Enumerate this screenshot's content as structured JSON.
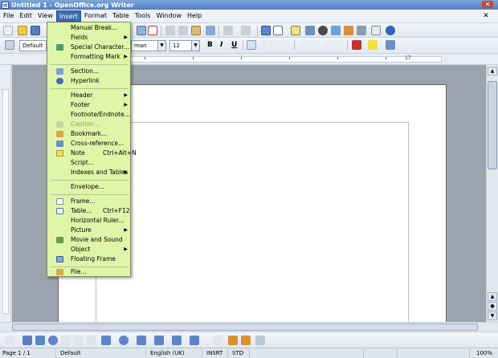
{
  "window": {
    "title": "Untitled 1 - OpenOffice.org Writer"
  },
  "menubar": [
    "File",
    "Edit",
    "View",
    "Insert",
    "Format",
    "Table",
    "Tools",
    "Window",
    "Help"
  ],
  "menubar_active": "Insert",
  "formatting": {
    "style": "Default",
    "font": "man",
    "size": "12"
  },
  "insert_menu": {
    "manual_break": "Manual Break...",
    "fields": "Fields",
    "special_character": "Special Character...",
    "formatting_mark": "Formatting Mark",
    "section": "Section...",
    "hyperlink": "Hyperlink",
    "header": "Header",
    "footer": "Footer",
    "footnote": "Footnote/Endnote...",
    "caption": "Caption...",
    "bookmark": "Bookmark...",
    "cross_reference": "Cross-reference...",
    "note": "Note",
    "note_shortcut": "Ctrl+Alt+N",
    "script": "Script...",
    "indexes": "Indexes and Tables",
    "envelope": "Envelope...",
    "frame": "Frame...",
    "table": "Table...",
    "table_shortcut": "Ctrl+F12",
    "horizontal_ruler": "Horizontal Ruler...",
    "picture": "Picture",
    "movie_sound": "Movie and Sound",
    "object": "Object",
    "floating_frame": "Floating Frame",
    "file": "File..."
  },
  "status": {
    "page": "Page 1 / 1",
    "style": "Default",
    "language": "English (UK)",
    "insert_mode": "INSRT",
    "selection_mode": "STD",
    "zoom": "100%"
  },
  "colors": {
    "menu_background": "#dff5a7",
    "active_menu": "#3d6ab4",
    "titlebar": "#4f7fc0"
  }
}
